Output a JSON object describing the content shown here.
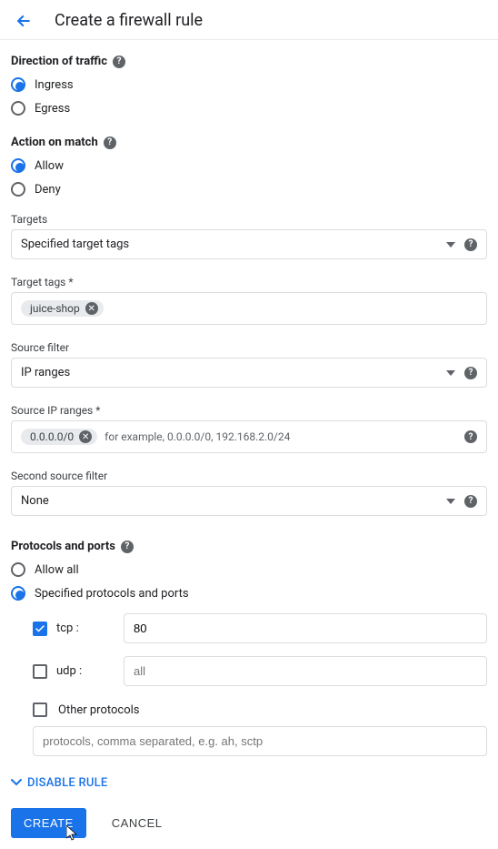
{
  "header": {
    "title": "Create a firewall rule"
  },
  "direction": {
    "label": "Direction of traffic",
    "options": {
      "ingress": "Ingress",
      "egress": "Egress"
    },
    "selected": "ingress"
  },
  "action": {
    "label": "Action on match",
    "options": {
      "allow": "Allow",
      "deny": "Deny"
    },
    "selected": "allow"
  },
  "targets": {
    "label": "Targets",
    "value": "Specified target tags"
  },
  "target_tags": {
    "label": "Target tags *",
    "chips": [
      "juice-shop"
    ]
  },
  "source_filter": {
    "label": "Source filter",
    "value": "IP ranges"
  },
  "source_ip_ranges": {
    "label": "Source IP ranges *",
    "chips": [
      "0.0.0.0/0"
    ],
    "hint": "for example, 0.0.0.0/0, 192.168.2.0/24"
  },
  "second_source_filter": {
    "label": "Second source filter",
    "value": "None"
  },
  "protocols": {
    "label": "Protocols and ports",
    "options": {
      "allow_all": "Allow all",
      "specified": "Specified protocols and ports"
    },
    "selected": "specified",
    "tcp": {
      "label": "tcp :",
      "checked": true,
      "value": "80"
    },
    "udp": {
      "label": "udp :",
      "checked": false,
      "placeholder": "all"
    },
    "other": {
      "label": "Other protocols",
      "checked": false,
      "placeholder": "protocols, comma separated, e.g. ah, sctp"
    }
  },
  "disable_rule": {
    "label": "DISABLE RULE"
  },
  "actions": {
    "create": "CREATE",
    "cancel": "CANCEL"
  }
}
